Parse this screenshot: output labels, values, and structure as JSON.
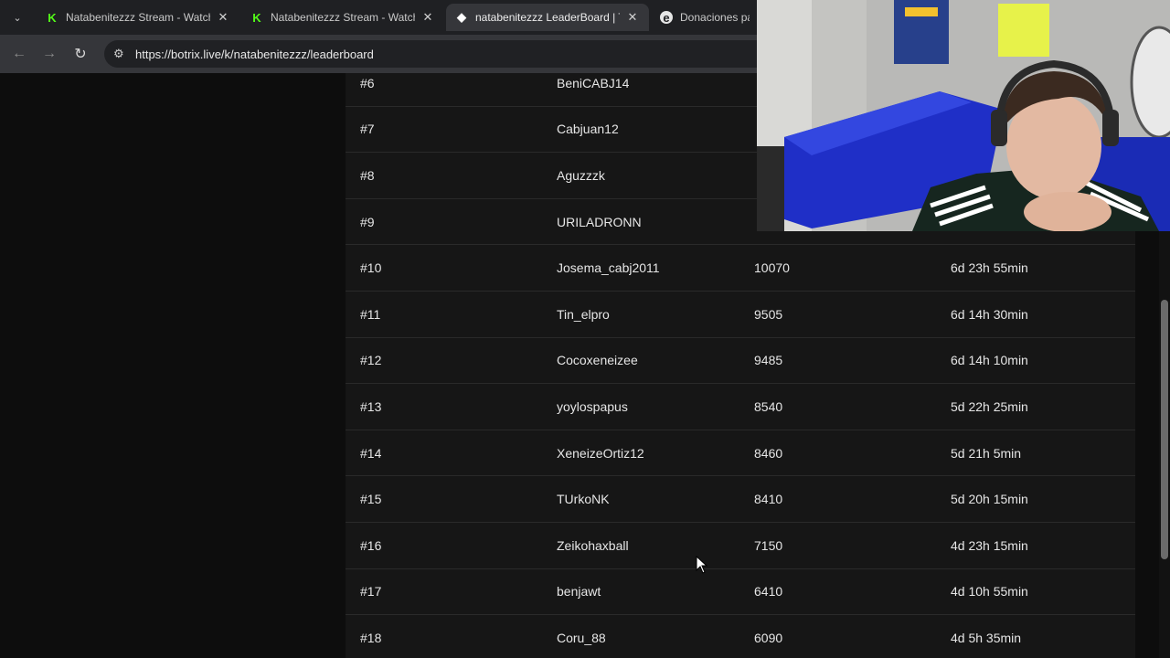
{
  "browser": {
    "tabs": [
      {
        "title": "Natabenitezzz Stream - Watch L",
        "favicon": "kick-icon",
        "active": false
      },
      {
        "title": "Natabenitezzz Stream - Watch L",
        "favicon": "kick-icon",
        "active": false
      },
      {
        "title": "natabenitezzz LeaderBoard | Th",
        "favicon": "diamond-icon",
        "active": true
      },
      {
        "title": "Donaciones para n",
        "favicon": "circle-icon",
        "active": false
      }
    ],
    "url": "https://botrix.live/k/natabenitezzz/leaderboard"
  },
  "leaderboard": {
    "rows": [
      {
        "rank": "#6",
        "name": "BeniCABJ14",
        "points": "",
        "time": ""
      },
      {
        "rank": "#7",
        "name": "Cabjuan12",
        "points": "",
        "time": ""
      },
      {
        "rank": "#8",
        "name": "Aguzzzk",
        "points": "",
        "time": ""
      },
      {
        "rank": "#9",
        "name": "URILADRONN",
        "points": "",
        "time": ""
      },
      {
        "rank": "#10",
        "name": "Josema_cabj2011",
        "points": "10070",
        "time": "6d 23h 55min"
      },
      {
        "rank": "#11",
        "name": "Tin_elpro",
        "points": "9505",
        "time": "6d 14h 30min"
      },
      {
        "rank": "#12",
        "name": "Cocoxeneizee",
        "points": "9485",
        "time": "6d 14h 10min"
      },
      {
        "rank": "#13",
        "name": "yoylospapus",
        "points": "8540",
        "time": "5d 22h 25min"
      },
      {
        "rank": "#14",
        "name": "XeneizeOrtiz12",
        "points": "8460",
        "time": "5d 21h 5min"
      },
      {
        "rank": "#15",
        "name": "TUrkoNK",
        "points": "8410",
        "time": "5d 20h 15min"
      },
      {
        "rank": "#16",
        "name": "Zeikohaxball",
        "points": "7150",
        "time": "4d 23h 15min"
      },
      {
        "rank": "#17",
        "name": "benjawt",
        "points": "6410",
        "time": "4d 10h 55min"
      },
      {
        "rank": "#18",
        "name": "Coru_88",
        "points": "6090",
        "time": "4d 5h 35min"
      }
    ]
  },
  "colors": {
    "kick_green": "#53fc18",
    "table_bg": "#161616",
    "page_bg": "#0d0d0d"
  }
}
